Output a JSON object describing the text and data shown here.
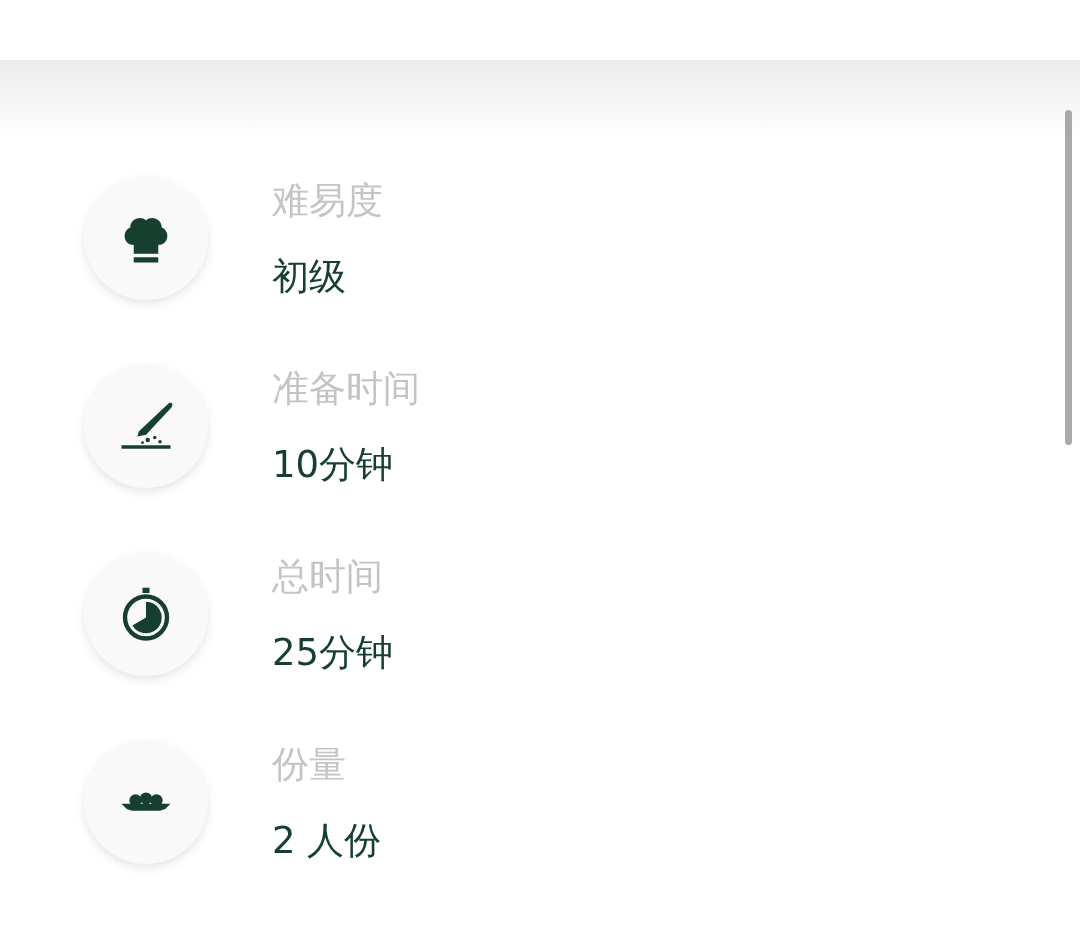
{
  "details": [
    {
      "kind": "difficulty",
      "label": "难易度",
      "value": "初级"
    },
    {
      "kind": "prep",
      "label": "准备时间",
      "value": "10分钟"
    },
    {
      "kind": "total",
      "label": "总时间",
      "value": "25分钟"
    },
    {
      "kind": "servings",
      "label": "份量",
      "value": "2 人份"
    }
  ]
}
